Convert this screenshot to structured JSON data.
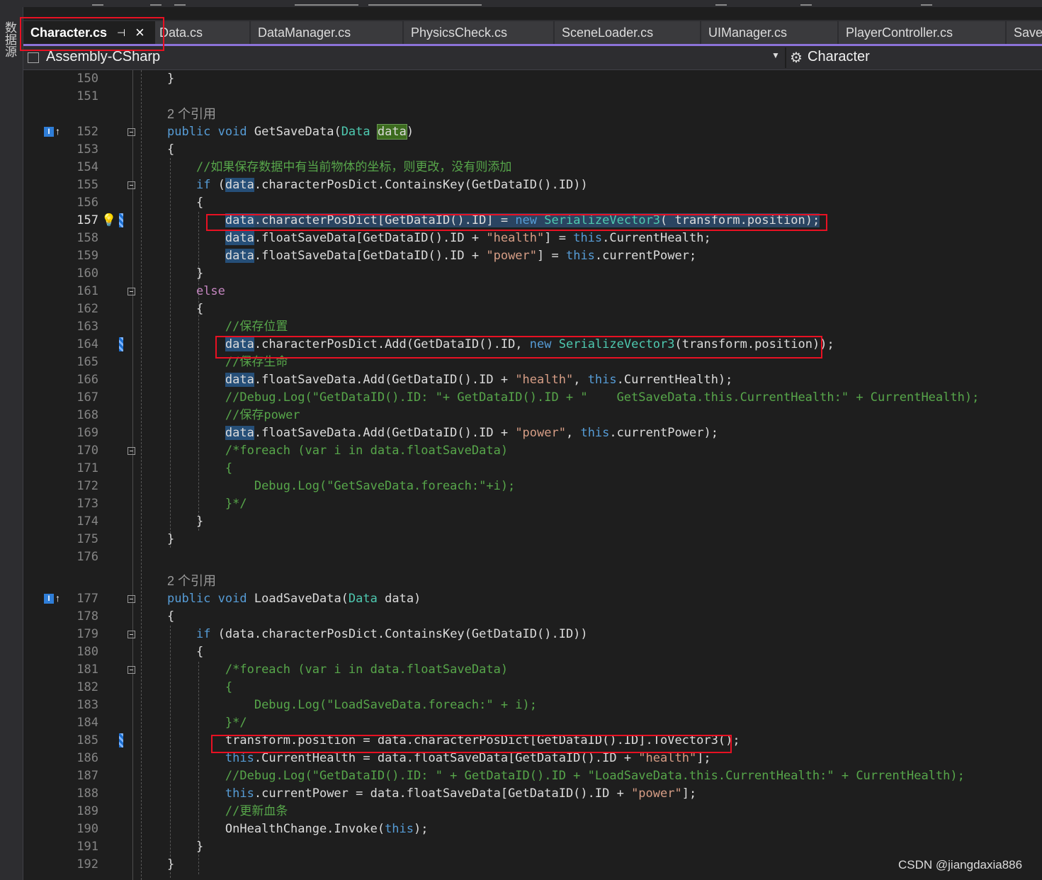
{
  "sidebar": {
    "label": "数据源"
  },
  "tabs": [
    {
      "label": "Character.cs",
      "active": true,
      "pin_icon": "pin-icon",
      "close_icon": "close-icon"
    },
    {
      "label": "Data.cs"
    },
    {
      "label": "DataManager.cs"
    },
    {
      "label": "PhysicsCheck.cs"
    },
    {
      "label": "SceneLoader.cs"
    },
    {
      "label": "UIManager.cs"
    },
    {
      "label": "PlayerController.cs"
    },
    {
      "label": "Save"
    }
  ],
  "nav": {
    "project": "Assembly-CSharp",
    "class_name": "Character"
  },
  "code_lens": {
    "text": "2 个引用"
  },
  "line_numbers": [
    "150",
    "151",
    "152",
    "153",
    "154",
    "155",
    "156",
    "157",
    "158",
    "159",
    "160",
    "161",
    "162",
    "163",
    "164",
    "165",
    "166",
    "167",
    "168",
    "169",
    "170",
    "171",
    "172",
    "173",
    "174",
    "175",
    "176",
    "177",
    "178",
    "179",
    "180",
    "181",
    "182",
    "183",
    "184",
    "185",
    "186",
    "187",
    "188",
    "189",
    "190",
    "191",
    "192"
  ],
  "code": {
    "tokens": {
      "brace_open": "{",
      "brace_close": "}",
      "public": "public",
      "void": "void",
      "Data": "Data",
      "data": "data",
      "if": "if",
      "else": "else",
      "new": "new",
      "SerializeVector3": "SerializeVector3",
      "this": "this",
      "str_health": "\"health\"",
      "str_power": "\"power\""
    },
    "l152": {
      "method": " GetSaveData(",
      "close": ")"
    },
    "l154": "//如果保存数据中有当前物体的坐标，则更改，没有则添加",
    "l155": {
      "open": " (",
      "rest": ".characterPosDict.ContainsKey(GetDataID().ID))"
    },
    "l157": {
      "a": ".characterPosDict[GetDataID().ID] = ",
      "b": "( transform.position);"
    },
    "l158": {
      "a": ".floatSaveData[GetDataID().ID + ",
      "b": "] = ",
      "c": ".CurrentHealth;"
    },
    "l159": {
      "a": ".floatSaveData[GetDataID().ID + ",
      "b": "] = ",
      "c": ".currentPower;"
    },
    "l163": "//保存位置",
    "l164": {
      "a": ".characterPosDict.Add(GetDataID().ID, ",
      "b": "(transform.position));"
    },
    "l165": "//保存生命",
    "l166": {
      "a": ".floatSaveData.Add(GetDataID().ID + ",
      "b": ", ",
      "c": ".CurrentHealth);"
    },
    "l167": "//Debug.Log(\"GetDataID().ID: \"+ GetDataID().ID + \"    GetSaveData.this.CurrentHealth:\" + CurrentHealth);",
    "l168": "//保存power",
    "l169": {
      "a": ".floatSaveData.Add(GetDataID().ID + ",
      "b": ", ",
      "c": ".currentPower);"
    },
    "l170": "/*foreach (var i in data.floatSaveData)",
    "l171": "{",
    "l172": "    Debug.Log(\"GetSaveData.foreach:\"+i);",
    "l173": "}*/",
    "l177": {
      "method": " LoadSaveData(",
      "param": " data)"
    },
    "l179": {
      "open": " (data.characterPosDict.ContainsKey(GetDataID().ID))"
    },
    "l181": "/*foreach (var i in data.floatSaveData)",
    "l182": "{",
    "l183": "    Debug.Log(\"LoadSaveData.foreach:\" + i);",
    "l184": "}*/",
    "l185": "transform.position = data.characterPosDict[GetDataID().ID].ToVector3();",
    "l186": {
      "a": ".CurrentHealth = data.floatSaveData[GetDataID().ID + ",
      "b": "];"
    },
    "l187": "//Debug.Log(\"GetDataID().ID: \" + GetDataID().ID + \"LoadSaveData.this.CurrentHealth:\" + CurrentHealth);",
    "l188": {
      "a": ".currentPower = data.floatSaveData[GetDataID().ID + ",
      "b": "];"
    },
    "l189": "//更新血条",
    "l190": {
      "a": "OnHealthChange.Invoke(",
      "b": ");"
    }
  },
  "watermark": "CSDN @jiangdaxia886",
  "colors": {
    "keyword": "#569cd6",
    "type": "#4ec9b0",
    "string": "#d69d85",
    "comment": "#57a64a",
    "annotation_box": "#e81123",
    "tab_accent": "#8c73d9"
  }
}
